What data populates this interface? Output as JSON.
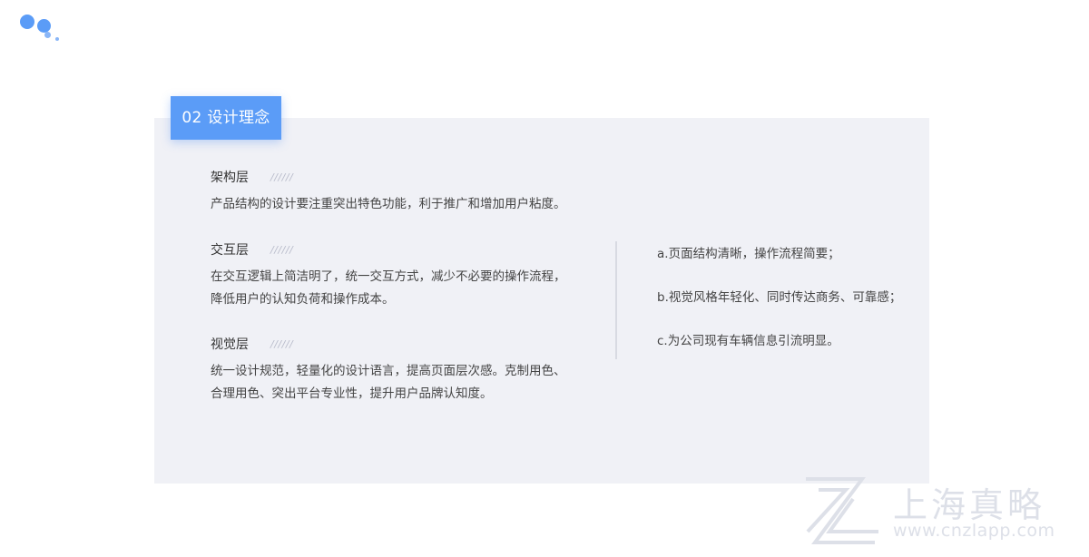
{
  "colors": {
    "accent": "#5b9cf7",
    "dot_light": "#8ab6f7",
    "panel_bg": "#f0f1f6",
    "text": "#444444",
    "watermark": "#dde0e8"
  },
  "logo": {
    "icon": "dots-logo-icon"
  },
  "tab": {
    "label": "02 设计理念"
  },
  "sections": [
    {
      "title": "架构层",
      "slashes": "//////",
      "lines": [
        "产品结构的设计要注重突出特色功能，利于推广和增加用户粘度。"
      ]
    },
    {
      "title": "交互层",
      "slashes": "//////",
      "lines": [
        "在交互逻辑上简洁明了，统一交互方式，减少不必要的操作流程，",
        "降低用户的认知负荷和操作成本。"
      ]
    },
    {
      "title": "视觉层",
      "slashes": "//////",
      "lines": [
        "统一设计规范，轻量化的设计语言，提高页面层次感。克制用色、",
        "合理用色、突出平台专业性，提升用户品牌认知度。"
      ]
    }
  ],
  "points": [
    "a.页面结构清晰，操作流程简要；",
    "b.视觉风格年轻化、同时传达商务、可靠感；",
    "c.为公司现有车辆信息引流明显。"
  ],
  "watermark": {
    "name": "上海真略",
    "url": "www.cnzlapp.com",
    "icon": "zl-logo-icon"
  }
}
